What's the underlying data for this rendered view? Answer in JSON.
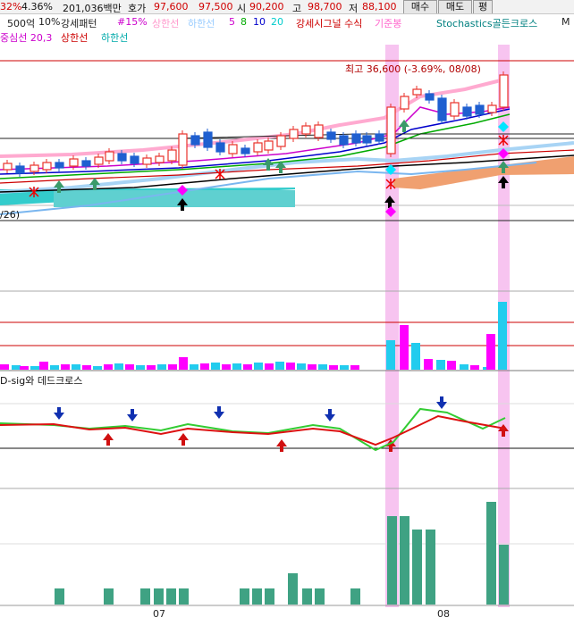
{
  "topbar": {
    "change_pct_partial": "32%",
    "turnover_pct": "4.36%",
    "volume_text": "201,036백만",
    "quote_label": "호가",
    "ask_price": "97,600",
    "bid_price": "97,500",
    "open_label": "시",
    "open_value": "90,200",
    "high_label": "고",
    "high_value": "98,700",
    "low_label": "저",
    "low_value": "88,100",
    "buy_button": "매수",
    "sell_button": "매도",
    "eval_button": "평"
  },
  "legend": {
    "line1": [
      {
        "text": "500억",
        "color": "#222222"
      },
      {
        "text": "10%",
        "color": "#222222"
      },
      {
        "text": "강세패턴",
        "color": "#222222"
      },
      {
        "text": "#15%",
        "color": "#cc00cc"
      },
      {
        "text": "상한선",
        "color": "#ff99cc"
      },
      {
        "text": "하한선",
        "color": "#99ccff"
      },
      {
        "text": "5",
        "color": "#cc00cc"
      },
      {
        "text": "8",
        "color": "#00aa00"
      },
      {
        "text": "10",
        "color": "#0000cc"
      },
      {
        "text": "20",
        "color": "#00cccc"
      },
      {
        "text": "강세시그널 수식",
        "color": "#cc0000"
      },
      {
        "text": "기준봉",
        "color": "#ff66cc"
      },
      {
        "text": "Stochastics골든크로스",
        "color": "#008080"
      },
      {
        "text": "M",
        "color": "#222222"
      }
    ],
    "line2": [
      {
        "text": "중심선 20,3",
        "color": "#cc00cc"
      },
      {
        "text": "상한선",
        "color": "#cc0000"
      },
      {
        "text": "하한선",
        "color": "#00aaaa"
      }
    ]
  },
  "price_panel": {
    "peak_annotation": "최고 36,600 (-3.69%, 08/08)",
    "ma_label_partial": "/26)"
  },
  "signal_panel": {
    "title": "D-sig와 데드크로스"
  },
  "x_axis": {
    "labels": [
      "07",
      "08"
    ]
  },
  "colors": {
    "up_candle": "#e8312a",
    "down_candle": "#1f5fd0",
    "highlight_band": "#f7c4f0",
    "ichimoku_cloud": "#f0a070",
    "cyan_cloud": "#33cccc",
    "volume_bar": "#3fa283",
    "osc_bar_magenta": "#ff00ff",
    "osc_bar_cyan": "#22ccee",
    "signal_green": "#33cc33",
    "signal_red": "#dd1111"
  }
}
